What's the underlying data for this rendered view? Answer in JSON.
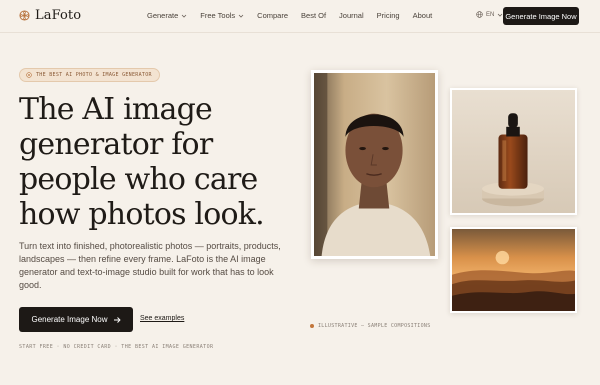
{
  "brand": {
    "name": "LaFoto",
    "icon": "flower-icon",
    "accent": "#b8743f"
  },
  "nav": {
    "items": [
      {
        "label": "Generate",
        "dropdown": true
      },
      {
        "label": "Free Tools",
        "dropdown": true
      },
      {
        "label": "Compare",
        "dropdown": false
      },
      {
        "label": "Best Of",
        "dropdown": false
      },
      {
        "label": "Journal",
        "dropdown": false
      },
      {
        "label": "Pricing",
        "dropdown": false
      },
      {
        "label": "About",
        "dropdown": false
      }
    ],
    "language": "EN",
    "cta": "Generate Image Now"
  },
  "hero": {
    "badge": "THE BEST AI PHOTO & IMAGE GENERATOR",
    "headline_lines": [
      "The AI image",
      "generator for",
      "people who care",
      "how photos look."
    ],
    "description": "Turn text into finished, photorealistic photos — portraits, products, landscapes — then refine every frame. LaFoto is the AI image generator and text-to-image studio built for work that has to look good.",
    "cta_primary": "Generate Image Now",
    "cta_secondary": "See examples",
    "footnote": "START FREE · NO CREDIT CARD · THE BEST AI IMAGE GENERATOR"
  },
  "gallery": {
    "caption": "ILLUSTRATIVE — SAMPLE COMPOSITIONS",
    "images": [
      "portrait-photo",
      "serum-bottle-photo",
      "sunset-hills-photo"
    ]
  },
  "colors": {
    "background": "#f6f1ea",
    "dark": "#1d1916",
    "badge_bg": "#f3e3d1",
    "badge_text": "#8a5a36"
  }
}
